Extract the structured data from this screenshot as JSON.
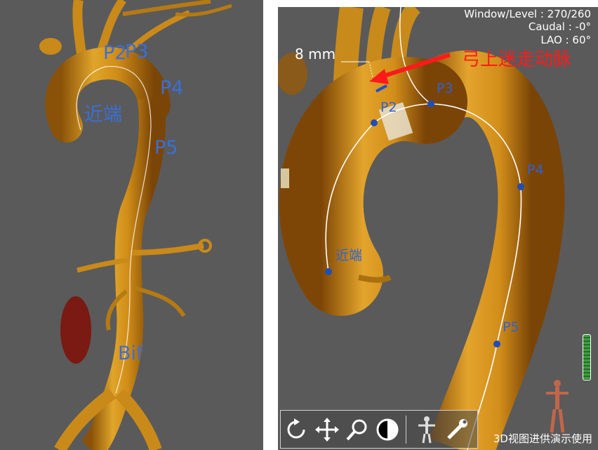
{
  "left_view": {
    "labels": {
      "p2": "P2",
      "p3": "P3",
      "p4": "P4",
      "p5": "P5",
      "proximal": "近端",
      "bifurcation": "Bif"
    }
  },
  "right_view": {
    "window_level": "Window/Level : 270/260",
    "caudal": "Caudal : -0°",
    "lao": "LAO : 60°",
    "measurement": "8 mm",
    "annotation": "弓上迷走动脉",
    "labels": {
      "p2": "P2",
      "p3": "P3",
      "p4": "P4",
      "p5": "P5",
      "proximal": "近端"
    },
    "demo_notice": "3D视图进供演示使用"
  },
  "toolbar": {
    "tools": [
      "rotate-icon",
      "pan-icon",
      "zoom-icon",
      "window-level-icon",
      "human-figure-icon",
      "wrench-icon"
    ]
  },
  "colors": {
    "background": "#5a5a5a",
    "vessel": "#d59a1c",
    "label_blue": "#3b6fd6",
    "annotation_red": "#ff1a1a",
    "centerline": "#ffffff"
  }
}
